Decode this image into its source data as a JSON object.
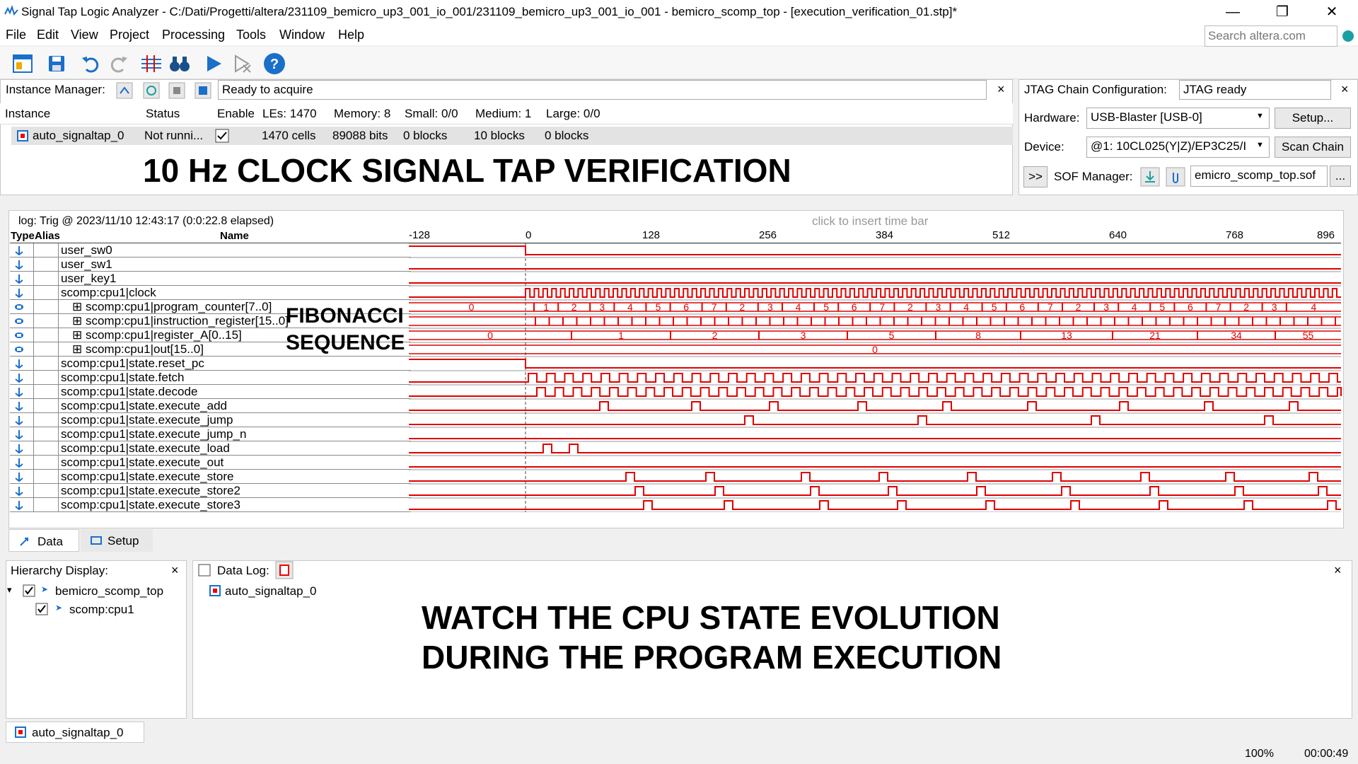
{
  "window": {
    "title": "Signal Tap Logic Analyzer - C:/Dati/Progetti/altera/231109_bemicro_up3_001_io_001/231109_bemicro_up3_001_io_001 - bemicro_scomp_top - [execution_verification_01.stp]*",
    "minimize": "—",
    "restore": "❐",
    "close": "✕"
  },
  "menu": [
    "File",
    "Edit",
    "View",
    "Project",
    "Processing",
    "Tools",
    "Window",
    "Help"
  ],
  "search_placeholder": "Search altera.com",
  "instance_manager": {
    "label": "Instance Manager:",
    "status": "Ready to acquire",
    "columns": [
      "Instance",
      "Status",
      "Enable",
      "LEs: 1470",
      "Memory: 8",
      "Small: 0/0",
      "Medium: 1",
      "Large: 0/0"
    ],
    "row": {
      "instance": "auto_signaltap_0",
      "status": "Not runni...",
      "les": "1470 cells",
      "memory": "89088 bits",
      "small": "0 blocks",
      "medium": "10 blocks",
      "large": "0 blocks"
    }
  },
  "jtag": {
    "label": "JTAG Chain Configuration:",
    "status": "JTAG ready",
    "hardware_label": "Hardware:",
    "hardware": "USB-Blaster [USB-0]",
    "setup": "Setup...",
    "device_label": "Device:",
    "device": "@1: 10CL025(Y|Z)/EP3C25/I",
    "scan": "Scan Chain",
    "sof_toggle": ">>",
    "sof_label": "SOF Manager:",
    "sof_file": "emicro_scomp_top.sof",
    "sof_browse": "..."
  },
  "annotations": {
    "headline": "10 Hz CLOCK SIGNAL TAP VERIFICATION",
    "fib1": "FIBONACCI",
    "fib2": "SEQUENCE",
    "watch1": "WATCH THE CPU STATE EVOLUTION",
    "watch2": "DURING THE PROGRAM EXECUTION"
  },
  "waveform": {
    "log": "log: Trig @ 2023/11/10 12:43:17 (0:0:22.8 elapsed)",
    "insert_hint": "click to insert time bar",
    "col_type": "Type",
    "col_alias": "Alias",
    "col_name": "Name",
    "ticks": [
      "-128",
      "0",
      "128",
      "256",
      "384",
      "512",
      "640",
      "768",
      "896"
    ],
    "signals": [
      "user_sw0",
      "user_sw1",
      "user_key1",
      "scomp:cpu1|clock",
      "scomp:cpu1|program_counter[7..0]",
      "scomp:cpu1|instruction_register[15..0]",
      "scomp:cpu1|register_A[0..15]",
      "scomp:cpu1|out[15..0]",
      "scomp:cpu1|state.reset_pc",
      "scomp:cpu1|state.fetch",
      "scomp:cpu1|state.decode",
      "scomp:cpu1|state.execute_add",
      "scomp:cpu1|state.execute_jump",
      "scomp:cpu1|state.execute_jump_n",
      "scomp:cpu1|state.execute_load",
      "scomp:cpu1|state.execute_out",
      "scomp:cpu1|state.execute_store",
      "scomp:cpu1|state.execute_store2",
      "scomp:cpu1|state.execute_store3"
    ],
    "pc_values": [
      "0",
      "1",
      "2",
      "3",
      "4",
      "5",
      "6",
      "7",
      "2",
      "3",
      "4",
      "5",
      "6",
      "7",
      "2",
      "3",
      "4",
      "5",
      "6",
      "7",
      "2",
      "3",
      "4",
      "5",
      "6",
      "7",
      "2",
      "3",
      "4"
    ],
    "regA_values": [
      "0",
      "1",
      "2",
      "3",
      "5",
      "8",
      "13",
      "21",
      "34",
      "55"
    ],
    "out_value": "0"
  },
  "tabs": {
    "data": "Data",
    "setup": "Setup"
  },
  "hierarchy": {
    "label": "Hierarchy Display:",
    "close": "×",
    "items": [
      "bemicro_scomp_top",
      "scomp:cpu1"
    ]
  },
  "datalog": {
    "label": "Data Log:",
    "close": "×",
    "item": "auto_signaltap_0"
  },
  "bottom_tab": "auto_signaltap_0",
  "status": {
    "zoom": "100%",
    "time": "00:00:49"
  },
  "colors": {
    "wave": "#e00000",
    "accent": "#1a6fc9"
  }
}
